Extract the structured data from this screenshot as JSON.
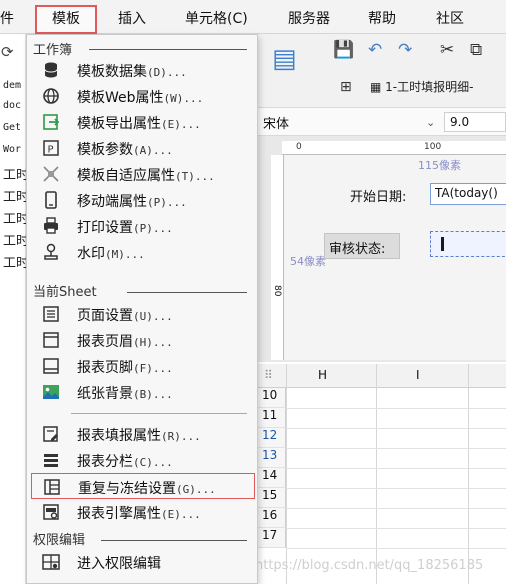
{
  "menubar": {
    "items": [
      "件",
      "模板",
      "插入",
      "单元格(C)",
      "服务器",
      "帮助",
      "社区"
    ],
    "active": "模板"
  },
  "left_pane": {
    "rows": [
      "dem",
      "doc",
      "Get",
      "Wor",
      "工时",
      "工时",
      "工时",
      "工时",
      "工时"
    ]
  },
  "editor": {
    "tab_title": "1-工时填报明细-",
    "font_name": "宋体",
    "font_size": "9.0",
    "ruler": [
      "0",
      "100"
    ],
    "px_label_top": "115像素",
    "px_label_left": "54像素",
    "start_date_label": "开始日期:",
    "start_date_formula": "TA(today()",
    "audit_label": "审核状态:",
    "ruler_left": "80",
    "columns": [
      "H",
      "I"
    ],
    "rows": [
      "10",
      "11",
      "12",
      "13",
      "14",
      "15",
      "16",
      "17"
    ],
    "watermark": "https://blog.csdn.net/qq_18256185"
  },
  "dropdown": {
    "section_workbook": "工作簿",
    "workbook_items": [
      {
        "label": "模板数据集",
        "shortcut": "(D)...",
        "icon": "database-icon"
      },
      {
        "label": "模板Web属性",
        "shortcut": "(W)...",
        "icon": "globe-icon"
      },
      {
        "label": "模板导出属性",
        "shortcut": "(E)...",
        "icon": "export-icon"
      },
      {
        "label": "模板参数",
        "shortcut": "(A)...",
        "icon": "parameter-icon"
      },
      {
        "label": "模板自适应属性",
        "shortcut": "(T)...",
        "icon": "autofit-icon"
      },
      {
        "label": "移动端属性",
        "shortcut": "(P)...",
        "icon": "mobile-icon"
      },
      {
        "label": "打印设置",
        "shortcut": "(P)...",
        "icon": "printer-icon"
      },
      {
        "label": "水印",
        "shortcut": "(M)...",
        "icon": "watermark-icon"
      }
    ],
    "section_sheet": "当前Sheet",
    "sheet_items": [
      {
        "label": "页面设置",
        "shortcut": "(U)...",
        "icon": "page-setup-icon"
      },
      {
        "label": "报表页眉",
        "shortcut": "(H)...",
        "icon": "header-icon"
      },
      {
        "label": "报表页脚",
        "shortcut": "(F)...",
        "icon": "footer-icon"
      },
      {
        "label": "纸张背景",
        "shortcut": "(B)...",
        "icon": "background-image-icon"
      }
    ],
    "sheet_items_2": [
      {
        "label": "报表填报属性",
        "shortcut": "(R)...",
        "icon": "fill-attr-icon"
      },
      {
        "label": "报表分栏",
        "shortcut": "(C)...",
        "icon": "columns-icon"
      },
      {
        "label": "重复与冻结设置",
        "shortcut": "(G)...",
        "icon": "freeze-icon"
      },
      {
        "label": "报表引擎属性",
        "shortcut": "(E)...",
        "icon": "engine-icon"
      }
    ],
    "section_permission": "权限编辑",
    "permission_items": [
      {
        "label": "进入权限编辑",
        "shortcut": "",
        "icon": "permission-icon"
      }
    ]
  },
  "colors": {
    "highlight": "#e05a5a",
    "menu_bg": "#f7f7f7",
    "selected_row_text": "#1a55a8"
  }
}
